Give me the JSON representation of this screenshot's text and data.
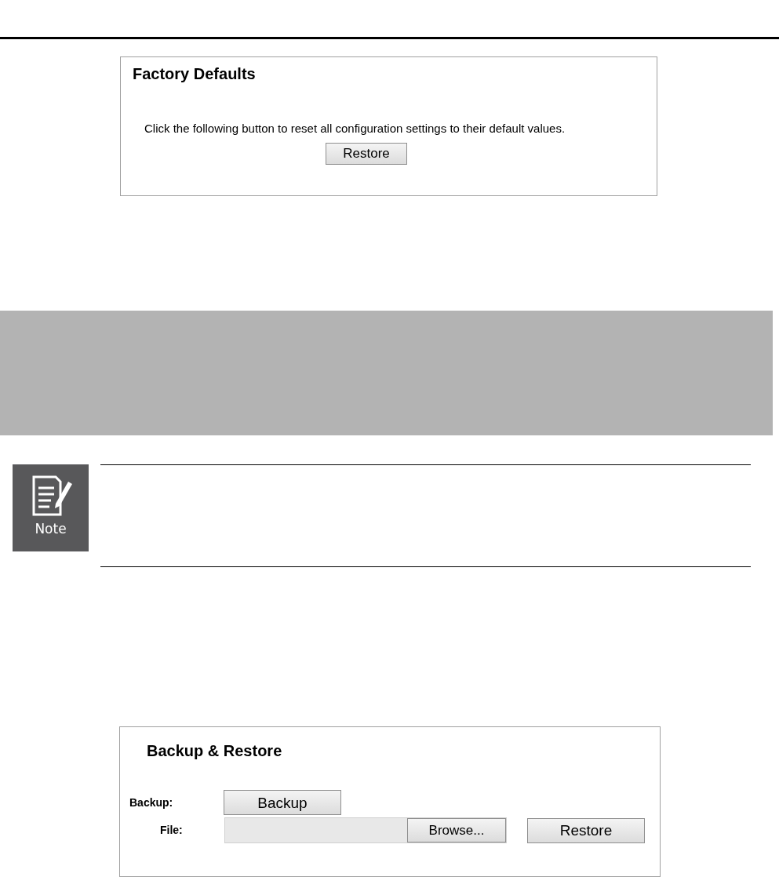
{
  "factory_defaults": {
    "title": "Factory Defaults",
    "description": "Click the following button to reset all configuration settings to their default values.",
    "button": "Restore"
  },
  "note": {
    "label": "Note"
  },
  "backup_restore": {
    "title": "Backup & Restore",
    "backup_label": "Backup:",
    "backup_button": "Backup",
    "file_label": "File:",
    "browse_button": "Browse...",
    "restore_button": "Restore"
  }
}
